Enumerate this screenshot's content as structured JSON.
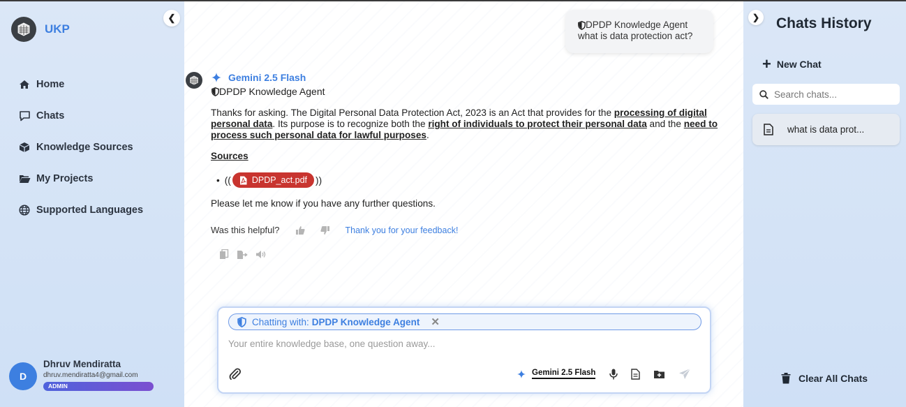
{
  "brand": {
    "name": "UKP",
    "logo_icon": "building-cube-icon"
  },
  "sidebar": {
    "collapse_icon": "chevron-left-icon",
    "items": [
      {
        "label": "Home",
        "icon": "home-icon"
      },
      {
        "label": "Chats",
        "icon": "chat-icon"
      },
      {
        "label": "Knowledge Sources",
        "icon": "cube-icon"
      },
      {
        "label": "My Projects",
        "icon": "folder-open-icon"
      },
      {
        "label": "Supported Languages",
        "icon": "globe-icon"
      }
    ]
  },
  "user": {
    "initial": "D",
    "name": "Dhruv Mendiratta",
    "email": "dhruv.mendiratta4@gmail.com",
    "role": "ADMIN"
  },
  "conversation": {
    "user_message": {
      "agent": "DPDP Knowledge Agent",
      "text": "what is data protection act?"
    },
    "response": {
      "model": "Gemini 2.5 Flash",
      "agent": "DPDP Knowledge Agent",
      "answer": {
        "p1": "Thanks for asking. The Digital Personal Data Protection Act, 2023 is an Act that provides for the ",
        "b1": "processing of digital personal data",
        "p2": ". Its purpose is to recognize both the ",
        "b2": "right of individuals to protect their personal data",
        "p3": " and the ",
        "b3": "need to process such personal data for lawful purposes",
        "p4": "."
      },
      "sources_title": "Sources",
      "source_prefix": "((",
      "source_file": "DPDP_act.pdf",
      "source_suffix": "))",
      "closing": "Please let me know if you have any further questions.",
      "feedback_question": "Was this helpful?",
      "feedback_thanks": "Thank you for your feedback!"
    }
  },
  "composer": {
    "chatting_prefix": "Chatting with:",
    "chatting_agent": "DPDP Knowledge Agent",
    "placeholder": "Your entire knowledge base, one question away...",
    "model": "Gemini 2.5 Flash"
  },
  "history": {
    "title": "Chats History",
    "new_chat": "New Chat",
    "search_placeholder": "Search chats...",
    "items": [
      {
        "label": "what is data prot..."
      }
    ],
    "clear_all": "Clear All Chats"
  },
  "colors": {
    "accent": "#3d7fe0",
    "sidebar_bg": "#d6e4f7",
    "pdf_chip": "#c8342f",
    "badge_gradient_start": "#4f63dc",
    "badge_gradient_end": "#7b4fd0"
  }
}
